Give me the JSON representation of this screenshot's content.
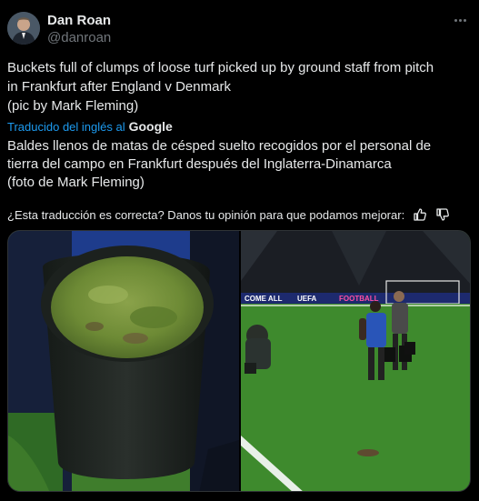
{
  "author": {
    "display_name": "Dan Roan",
    "handle": "@danroan",
    "avatar_icon": "person-avatar-icon"
  },
  "tweet": {
    "text_lines": [
      "Buckets full of clumps of loose turf picked up by ground staff from pitch",
      "in Frankfurt after England v Denmark",
      "(pic by Mark Fleming)"
    ],
    "translated_from_label": "Traducido del inglés al",
    "translator": "Google",
    "translation_lines": [
      "Baldes llenos de matas de césped suelto recogidos por el personal de",
      "tierra del campo en Frankfurt después del Inglaterra-Dinamarca",
      "(foto de Mark Fleming)"
    ],
    "feedback_prompt": "¿Esta traducción es correcta? Danos tu opinión para que podamos mejorar:"
  },
  "stadium_boards": {
    "left": "COME ALL",
    "center": "UEFA",
    "right": "FOOTBALL"
  },
  "icons": {
    "more": "more-options-icon",
    "thumbs_up": "thumbs-up-icon",
    "thumbs_down": "thumbs-down-icon"
  },
  "colors": {
    "background": "#000000",
    "text": "#e7e9ea",
    "muted": "#71767b",
    "link": "#1d9bf0"
  }
}
